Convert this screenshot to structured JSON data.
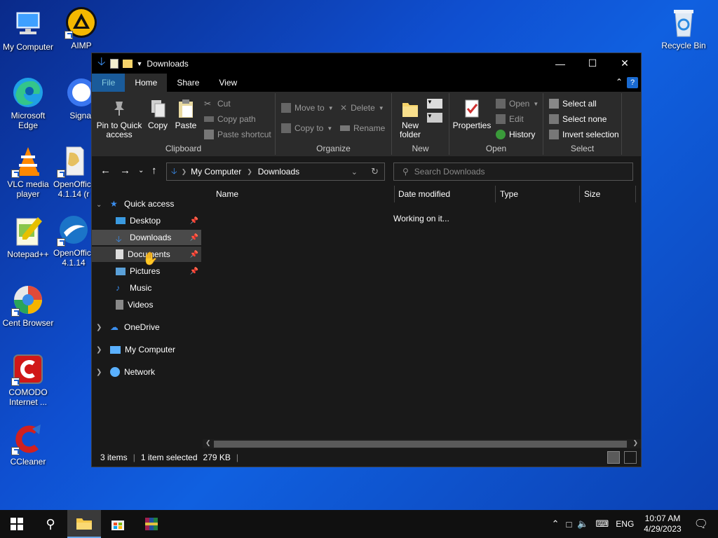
{
  "desktop_icons": [
    {
      "label": "My Computer",
      "icon": "computer-icon"
    },
    {
      "label": "AIMP",
      "icon": "aimp-icon"
    },
    {
      "label": "Recycle Bin",
      "icon": "recycle-bin-icon"
    },
    {
      "label": "Microsoft Edge",
      "icon": "edge-icon"
    },
    {
      "label": "Signal",
      "icon": "signal-icon"
    },
    {
      "label": "VLC media player",
      "icon": "vlc-icon"
    },
    {
      "label": "OpenOffice 4.1.14 (r",
      "icon": "openoffice-icon"
    },
    {
      "label": "Notepad++",
      "icon": "notepadpp-icon"
    },
    {
      "label": "OpenOffice 4.1.14",
      "icon": "openoffice-writer-icon"
    },
    {
      "label": "Cent Browser",
      "icon": "cent-browser-icon"
    },
    {
      "label": "COMODO Internet ...",
      "icon": "comodo-icon"
    },
    {
      "label": "CCleaner",
      "icon": "ccleaner-icon"
    }
  ],
  "window": {
    "title": "Downloads",
    "tabs": {
      "file": "File",
      "home": "Home",
      "share": "Share",
      "view": "View"
    },
    "ribbon": {
      "clipboard": {
        "label": "Clipboard",
        "pin": "Pin to Quick access",
        "copy": "Copy",
        "paste": "Paste",
        "cut": "Cut",
        "copy_path": "Copy path",
        "paste_shortcut": "Paste shortcut"
      },
      "organize": {
        "label": "Organize",
        "move_to": "Move to",
        "copy_to": "Copy to",
        "delete": "Delete",
        "rename": "Rename"
      },
      "new": {
        "label": "New",
        "new_folder": "New folder"
      },
      "open": {
        "label": "Open",
        "properties": "Properties",
        "open": "Open",
        "edit": "Edit",
        "history": "History"
      },
      "select": {
        "label": "Select",
        "select_all": "Select all",
        "select_none": "Select none",
        "invert": "Invert selection"
      }
    },
    "address": {
      "root": "My Computer",
      "current": "Downloads"
    },
    "search": {
      "placeholder": "Search Downloads"
    },
    "nav": {
      "quick_access": "Quick access",
      "desktop": "Desktop",
      "downloads": "Downloads",
      "documents": "Documents",
      "pictures": "Pictures",
      "music": "Music",
      "videos": "Videos",
      "onedrive": "OneDrive",
      "my_computer": "My Computer",
      "network": "Network"
    },
    "columns": {
      "name": "Name",
      "date": "Date modified",
      "type": "Type",
      "size": "Size"
    },
    "status_message": "Working on it...",
    "statusbar": {
      "items": "3 items",
      "selected": "1 item selected",
      "size": "279 KB"
    }
  },
  "taskbar": {
    "lang": "ENG",
    "time": "10:07 AM",
    "date": "4/29/2023"
  },
  "colors": {
    "accent": "#1a5b9a",
    "desktop": "#0f4fd0",
    "window_bg": "#191919"
  }
}
